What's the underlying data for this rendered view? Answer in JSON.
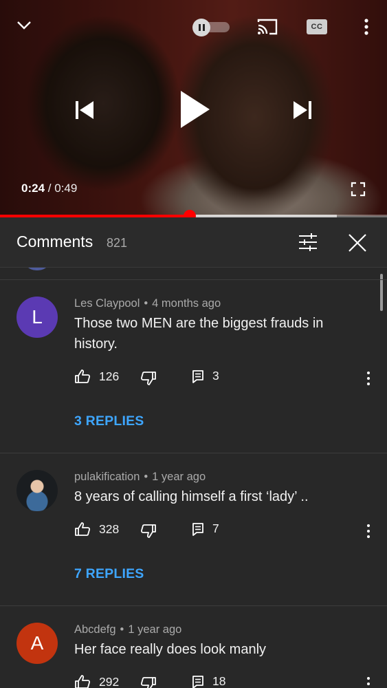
{
  "player": {
    "current_time": "0:24",
    "separator": "/",
    "duration": "0:49",
    "played_fraction": 0.49,
    "buffered_fraction": 0.87,
    "cc_label": "CC",
    "icons": [
      "chevron-down-icon",
      "pause-toggle",
      "cast-icon",
      "cc-icon",
      "more-vert-icon",
      "skip-previous-icon",
      "play-icon",
      "skip-next-icon",
      "fullscreen-icon"
    ]
  },
  "comments_panel": {
    "title": "Comments",
    "count": "821",
    "icons": [
      "filter-icon",
      "close-icon"
    ]
  },
  "comments": [
    {
      "author": "Les Claypool",
      "dot": "•",
      "age": "4 months ago",
      "avatar_letter": "L",
      "avatar_color": "#5b3ab3",
      "text": "Those two MEN are the biggest frauds in history.",
      "likes": "126",
      "reply_count": "3",
      "replies_label": "3 REPLIES"
    },
    {
      "author": "pulakification",
      "dot": "•",
      "age": "1 year ago",
      "avatar_letter": "",
      "avatar_color": "#1a1d20",
      "text": "8 years of calling himself a first ‘lady’ ..",
      "likes": "328",
      "reply_count": "7",
      "replies_label": "7 REPLIES"
    },
    {
      "author": "Abcdefg",
      "dot": "•",
      "age": "1 year ago",
      "avatar_letter": "A",
      "avatar_color": "#c2340f",
      "text": "Her face really does look manly",
      "likes": "292",
      "reply_count": "18"
    }
  ],
  "colors": {
    "background": "#282828",
    "accent_red": "#ff0000",
    "link_blue": "#3ea6ff"
  }
}
